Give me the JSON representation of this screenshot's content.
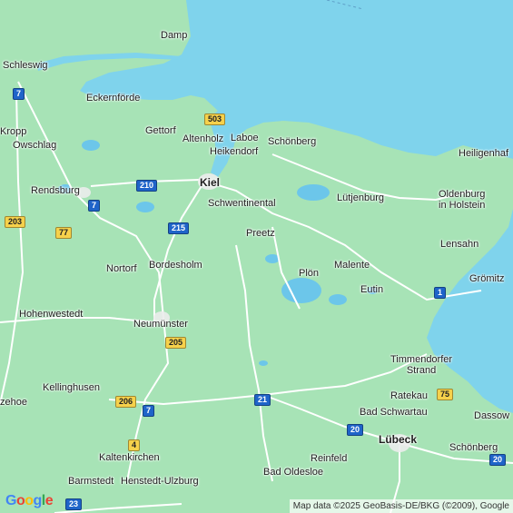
{
  "map": {
    "colors": {
      "land": "#a7e3b6",
      "water": "#7fd3ec",
      "road": "#ffffff",
      "lake": "#6cc6ea"
    },
    "places": [
      {
        "name": "Damp",
        "kind": "town"
      },
      {
        "name": "Schleswig",
        "kind": "town"
      },
      {
        "name": "Eckernförde",
        "kind": "town"
      },
      {
        "name": "Kropp",
        "kind": "town"
      },
      {
        "name": "Owschlag",
        "kind": "town"
      },
      {
        "name": "Gettorf",
        "kind": "town"
      },
      {
        "name": "Altenholz",
        "kind": "town"
      },
      {
        "name": "Laboe",
        "kind": "town"
      },
      {
        "name": "Heikendorf",
        "kind": "town"
      },
      {
        "name": "Schönberg",
        "kind": "town"
      },
      {
        "name": "Heiligenhaf",
        "kind": "town"
      },
      {
        "name": "Kiel",
        "kind": "city"
      },
      {
        "name": "Rendsburg",
        "kind": "town"
      },
      {
        "name": "Schwentinental",
        "kind": "town"
      },
      {
        "name": "Lütjenburg",
        "kind": "town"
      },
      {
        "name": "Oldenburg\nin Holstein",
        "kind": "town"
      },
      {
        "name": "Preetz",
        "kind": "town"
      },
      {
        "name": "Lensahn",
        "kind": "town"
      },
      {
        "name": "Nortorf",
        "kind": "town"
      },
      {
        "name": "Bordesholm",
        "kind": "town"
      },
      {
        "name": "Plön",
        "kind": "town"
      },
      {
        "name": "Malente",
        "kind": "town"
      },
      {
        "name": "Grömitz",
        "kind": "town"
      },
      {
        "name": "Eutin",
        "kind": "town"
      },
      {
        "name": "Hohenwestedt",
        "kind": "town"
      },
      {
        "name": "Neumünster",
        "kind": "town"
      },
      {
        "name": "Timmendorfer\nStrand",
        "kind": "town"
      },
      {
        "name": "Kellinghusen",
        "kind": "town"
      },
      {
        "name": "Ratekau",
        "kind": "town"
      },
      {
        "name": "zehoe",
        "kind": "town"
      },
      {
        "name": "Bad Schwartau",
        "kind": "town"
      },
      {
        "name": "Dassow",
        "kind": "town"
      },
      {
        "name": "Lübeck",
        "kind": "city"
      },
      {
        "name": "Schönberg",
        "kind": "town"
      },
      {
        "name": "Kaltenkirchen",
        "kind": "town"
      },
      {
        "name": "Reinfeld",
        "kind": "town"
      },
      {
        "name": "Barmstedt",
        "kind": "town"
      },
      {
        "name": "Henstedt-Ulzburg",
        "kind": "town"
      },
      {
        "name": "Bad Oldesloe",
        "kind": "town"
      }
    ],
    "shields": [
      {
        "label": "7",
        "kind": "motorway"
      },
      {
        "label": "503",
        "kind": "federal"
      },
      {
        "label": "210",
        "kind": "motorway"
      },
      {
        "label": "7",
        "kind": "motorway"
      },
      {
        "label": "203",
        "kind": "federal"
      },
      {
        "label": "215",
        "kind": "motorway"
      },
      {
        "label": "77",
        "kind": "federal"
      },
      {
        "label": "1",
        "kind": "motorway"
      },
      {
        "label": "205",
        "kind": "federal"
      },
      {
        "label": "206",
        "kind": "federal"
      },
      {
        "label": "21",
        "kind": "motorway"
      },
      {
        "label": "75",
        "kind": "federal"
      },
      {
        "label": "7",
        "kind": "motorway"
      },
      {
        "label": "20",
        "kind": "motorway"
      },
      {
        "label": "20",
        "kind": "motorway"
      },
      {
        "label": "4",
        "kind": "federal"
      },
      {
        "label": "23",
        "kind": "motorway"
      }
    ]
  },
  "logo": "Google",
  "attribution": "Map data ©2025 GeoBasis-DE/BKG (©2009), Google"
}
